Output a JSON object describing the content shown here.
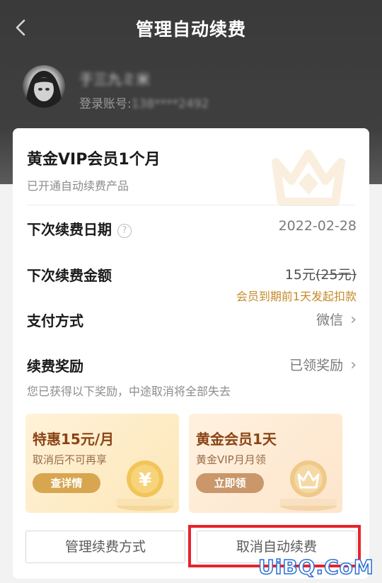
{
  "header": {
    "title": "管理自动续费"
  },
  "user": {
    "name": "于三九ミ米",
    "account_label": "登录账号:",
    "account_value": "138****2492"
  },
  "plan": {
    "title": "黄金VIP会员1个月",
    "subtitle": "已开通自动续费产品"
  },
  "renewal": {
    "date_label": "下次续费日期",
    "date_value": "2022-02-28",
    "amount_label": "下次续费金额",
    "amount_current": "15元",
    "amount_original": "(25元)",
    "amount_note": "会员到期前1天发起扣款",
    "payment_label": "支付方式",
    "payment_value": "微信",
    "reward_label": "续费奖励",
    "reward_value": "已领奖励",
    "reward_note": "您已获得以下奖励，中途取消将全部失去"
  },
  "benefits": [
    {
      "title": "特惠15元/月",
      "desc": "取消后不可再享",
      "button": "查详情"
    },
    {
      "title": "黄金会员1天",
      "desc": "黄金VIP月月领",
      "button": "立即领"
    }
  ],
  "actions": {
    "manage_label": "管理续费方式",
    "cancel_label": "取消自动续费"
  },
  "watermark": "UiBQ.CoM",
  "colors": {
    "accent_gold": "#c58a2c",
    "highlight_red": "#e8232b"
  }
}
